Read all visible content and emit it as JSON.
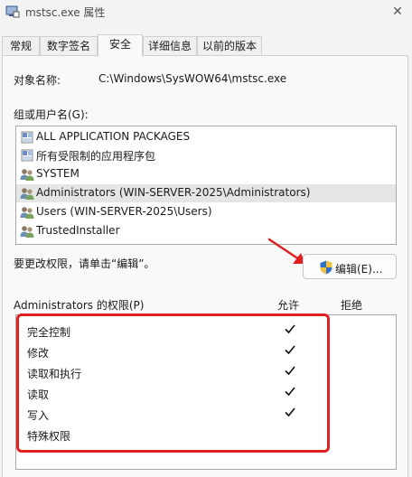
{
  "window": {
    "title": "mstsc.exe 属性",
    "close_icon": "close-icon"
  },
  "tabs": [
    {
      "label": "常规",
      "active": false
    },
    {
      "label": "数字签名",
      "active": false
    },
    {
      "label": "安全",
      "active": true
    },
    {
      "label": "详细信息",
      "active": false
    },
    {
      "label": "以前的版本",
      "active": false
    }
  ],
  "object": {
    "label": "对象名称:",
    "value": "C:\\Windows\\SysWOW64\\mstsc.exe"
  },
  "groups": {
    "label": "组或用户名(G):",
    "items": [
      {
        "label": "ALL APPLICATION PACKAGES",
        "icon": "package-icon"
      },
      {
        "label": "所有受限制的应用程序包",
        "icon": "package-icon"
      },
      {
        "label": "SYSTEM",
        "icon": "users-icon"
      },
      {
        "label": "Administrators (WIN-SERVER-2025\\Administrators)",
        "icon": "users-icon",
        "selected": true
      },
      {
        "label": "Users (WIN-SERVER-2025\\Users)",
        "icon": "users-icon"
      },
      {
        "label": "TrustedInstaller",
        "icon": "users-icon"
      }
    ]
  },
  "edit": {
    "hint": "要更改权限，请单击“编辑”。",
    "button_label": "编辑(E)..."
  },
  "permissions": {
    "title": "Administrators 的权限(P)",
    "allow_header": "允许",
    "deny_header": "拒绝",
    "rows": [
      {
        "name": "完全控制",
        "allow": true,
        "deny": false
      },
      {
        "name": "修改",
        "allow": true,
        "deny": false
      },
      {
        "name": "读取和执行",
        "allow": true,
        "deny": false
      },
      {
        "name": "读取",
        "allow": true,
        "deny": false
      },
      {
        "name": "写入",
        "allow": true,
        "deny": false
      },
      {
        "name": "特殊权限",
        "allow": false,
        "deny": false
      }
    ]
  },
  "colors": {
    "highlight": "#e02020",
    "shield_blue": "#2f6fd0",
    "shield_yellow": "#f2c230"
  }
}
